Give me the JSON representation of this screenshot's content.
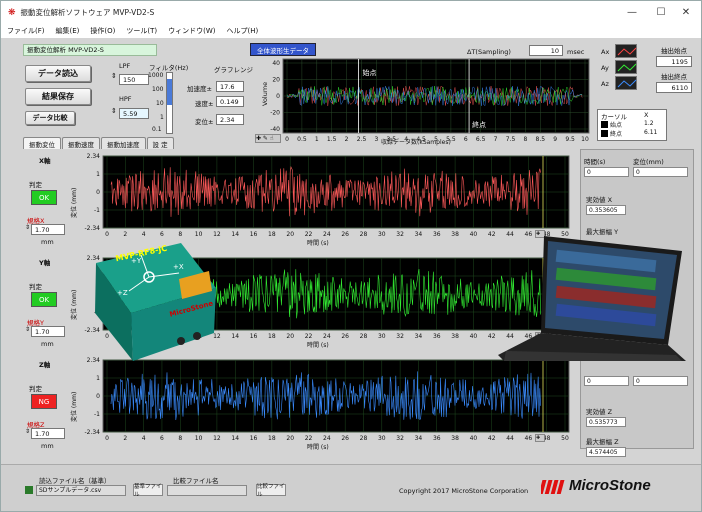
{
  "window": {
    "title": "振動変位解析ソフトウェア MVP-VD2-S",
    "minimize": "—",
    "maximize": "☐",
    "close": "✕"
  },
  "menu": [
    "ファイル(F)",
    "編集(E)",
    "操作(O)",
    "ツール(T)",
    "ウィンドウ(W)",
    "ヘルプ(H)"
  ],
  "left": {
    "app_label": "振動変位解析 MVP-VD2-S",
    "load_button": "データ読込",
    "save_button": "結果保存",
    "compare_button": "データ比較",
    "lpf_label": "LPF",
    "lpf_value": "150",
    "hpf_label": "HPF",
    "hpf_value": "5.59",
    "filter_label": "フィルタ(Hz)",
    "filter_ticks": [
      "1000",
      "100",
      "10",
      "1",
      "0.1"
    ]
  },
  "graph_range": {
    "title": "グラフレンジ",
    "accel_label": "加速度±",
    "accel_value": "17.6",
    "vel_label": "速度±",
    "vel_value": "0.149",
    "disp_label": "変位±",
    "disp_value": "2.34"
  },
  "overview": {
    "button": "全体波形生データ",
    "sampling_label": "ΔT(Sampling)",
    "sampling_value": "10",
    "sampling_unit": "msec",
    "ylabel": "Volume",
    "xlabel": "収録データ数(kSamples)",
    "start_marker": "始点",
    "end_marker": "終点",
    "yticks": [
      "40",
      "20",
      "0",
      "-20",
      "-40"
    ],
    "xticks": [
      "0",
      "0.5",
      "1",
      "1.5",
      "2",
      "2.5",
      "3",
      "3.5",
      "4",
      "4.5",
      "5",
      "5.5",
      "6",
      "6.5",
      "7",
      "7.5",
      "8",
      "8.5",
      "9",
      "9.5",
      "10"
    ]
  },
  "axes_legend": [
    "Ax",
    "Ay",
    "Az"
  ],
  "points": {
    "start_label": "抽出始点",
    "start_value": "1195",
    "end_label": "抽出終点",
    "end_value": "6110"
  },
  "cursor_table": {
    "col1": "カーソル",
    "col2": "X",
    "rows": [
      {
        "name": "始点",
        "x": "1.2"
      },
      {
        "name": "終点",
        "x": "6.11"
      }
    ]
  },
  "tabs": [
    "振動変位",
    "振動速度",
    "振動加速度",
    "設 定"
  ],
  "channels": [
    {
      "axis": "X軸",
      "judge_label": "判定",
      "judge": "OK",
      "judge_color": "#22cc22",
      "limit_label": "規格X",
      "limit": "1.70",
      "unit": "mm",
      "color": "#ff5a5a",
      "ylabel": "変位 (mm)",
      "xlabel": "時間 (s)",
      "ymax": "2.34",
      "ymin": "-2.34",
      "yticks": [
        "1",
        "0",
        "-1"
      ]
    },
    {
      "axis": "Y軸",
      "judge_label": "判定",
      "judge": "OK",
      "judge_color": "#22cc22",
      "limit_label": "規格Y",
      "limit": "1.70",
      "unit": "mm",
      "color": "#33ee33",
      "ylabel": "変位 (mm)",
      "xlabel": "時間 (s)",
      "ymax": "2.34",
      "ymin": "-2.34",
      "yticks": [
        "1",
        "0",
        "-1"
      ]
    },
    {
      "axis": "Z軸",
      "judge_label": "判定",
      "judge": "NG",
      "judge_color": "#ee2222",
      "limit_label": "規格Z",
      "limit": "1.70",
      "unit": "mm",
      "color": "#3a8cff",
      "ylabel": "変位 (mm)",
      "xlabel": "時間 (s)",
      "ymax": "2.34",
      "ymin": "-2.34",
      "yticks": [
        "1",
        "0",
        "-1"
      ]
    }
  ],
  "time_ticks": [
    "0",
    "2",
    "4",
    "6",
    "8",
    "10",
    "12",
    "14",
    "16",
    "18",
    "20",
    "22",
    "24",
    "26",
    "28",
    "30",
    "32",
    "34",
    "36",
    "38",
    "40",
    "42",
    "44",
    "46",
    "48",
    "50"
  ],
  "right": {
    "time_label": "時間(s)",
    "time_value": "0",
    "disp_label": "変位(mm)",
    "disp_value": "0",
    "eff_x_label": "実効値 X",
    "eff_x_value": "0.353605",
    "max_y_label": "最大振幅 Y",
    "z_time": "0",
    "z_disp": "0",
    "eff_z_label": "実効値 Z",
    "eff_z_value": "0.535773",
    "max_z_label": "最大振幅 Z",
    "max_z_value": "4.574405"
  },
  "device": {
    "brand": "MicroStone",
    "model": "MVP-RF8-JC",
    "axes": [
      "+Y",
      "+X",
      "+Z"
    ]
  },
  "footer": {
    "file_label": "読込ファイル名（基準）",
    "file_name": "SDサンプルデータ.csv",
    "ref_button": "基準ファイル",
    "compare_label": "比較ファイル名",
    "compare_button": "比較ファイル",
    "copyright": "Copyright 2017 MicroStone Corporation",
    "logo": "MicroStone"
  }
}
